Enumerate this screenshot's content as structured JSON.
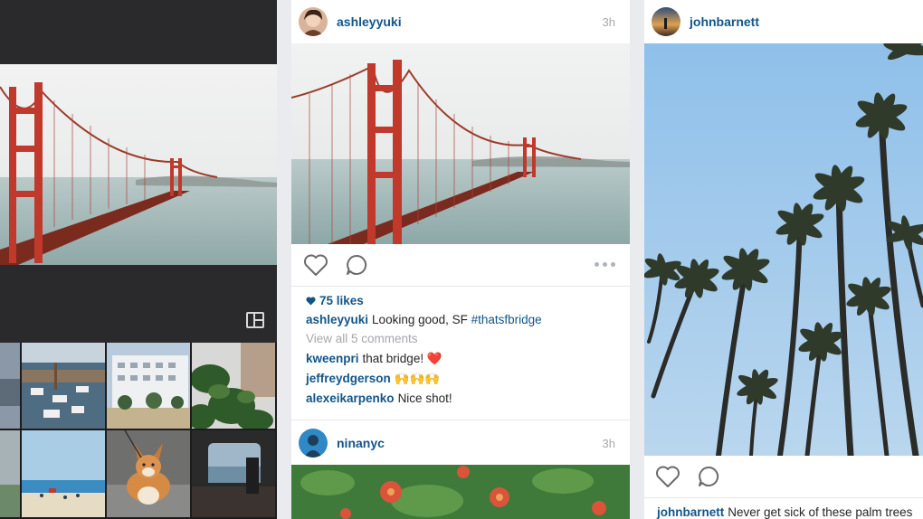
{
  "feed_post_1": {
    "username": "ashleyyuki",
    "time": "3h",
    "likes": "75 likes",
    "caption_user": "ashleyyuki",
    "caption_text": "Looking good, SF",
    "caption_tag": "#thatsfbridge",
    "view_all": "View all 5 comments",
    "comments": [
      {
        "user": "kweenpri",
        "text": "that bridge!",
        "emoji": "❤️"
      },
      {
        "user": "jeffreydgerson",
        "text": "",
        "emoji": "🙌🙌🙌"
      },
      {
        "user": "alexeikarpenko",
        "text": "Nice shot!",
        "emoji": ""
      }
    ]
  },
  "feed_post_2": {
    "username": "ninanyc",
    "time": "3h"
  },
  "feed_post_3": {
    "username": "johnbarnett",
    "caption_user": "johnbarnett",
    "caption_text": "Never get sick of these palm trees"
  },
  "icons": {
    "layout": "layout-icon",
    "heart": "heart-icon",
    "comment": "comment-icon",
    "more": "more-options-icon"
  },
  "colors": {
    "link_blue": "#125688",
    "muted": "#a5a7aa",
    "editor_bg": "#1c1c1e"
  }
}
